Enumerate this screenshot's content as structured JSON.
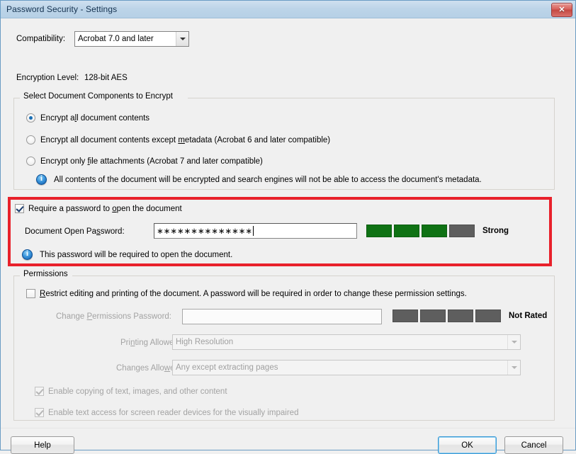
{
  "window": {
    "title": "Password Security - Settings",
    "close_label": "✕"
  },
  "compatibility": {
    "label": "Compatibility:",
    "value": "Acrobat 7.0 and later"
  },
  "encryption": {
    "label": "Encryption  Level:",
    "value": "128-bit AES"
  },
  "encrypt_group": {
    "legend": "Select Document Components to Encrypt",
    "options": [
      {
        "label_pre": "Encrypt a",
        "mnemonic": "l",
        "label_post": "l document contents",
        "checked": true
      },
      {
        "label_pre": "Encrypt all document contents except ",
        "mnemonic": "m",
        "label_post": "etadata (Acrobat 6 and later compatible)",
        "checked": false
      },
      {
        "label_pre": "Encrypt only ",
        "mnemonic": "f",
        "label_post": "ile attachments (Acrobat 7 and later compatible)",
        "checked": false
      }
    ],
    "info_text": "All contents of the document will be encrypted and search engines will not be able to access the document's metadata.",
    "info_icon": "info-icon"
  },
  "open_password": {
    "checkbox_pre": "Require a password to ",
    "checkbox_mnemonic": "o",
    "checkbox_post": "pen the document",
    "checkbox_checked": true,
    "field_label_pre": "Document Open Pa",
    "field_label_mnemonic": "s",
    "field_label_post": "sword:",
    "field_value": "∗∗∗∗∗∗∗∗∗∗∗∗∗∗",
    "strength_label": "Strong",
    "strength_filled": 3,
    "strength_total": 4,
    "info_text": "This password will be required to open the document.",
    "info_icon": "info-icon"
  },
  "permissions_group": {
    "legend": "Permissions",
    "restrict_pre": "",
    "restrict_mnemonic": "R",
    "restrict_post": "estrict editing and printing of the document. A password will be required in order to change these permission settings.",
    "restrict_checked": false,
    "perm_password_label_pre": "Change ",
    "perm_password_label_mnemonic": "P",
    "perm_password_label_post": "ermissions Password:",
    "perm_password_value": "",
    "perm_strength_label": "Not Rated",
    "perm_strength_filled": 0,
    "perm_strength_total": 4,
    "printing": {
      "label_pre": "Pri",
      "label_mnemonic": "n",
      "label_post": "ting Allowed:",
      "value": "High Resolution"
    },
    "changes": {
      "label_pre": "Changes Allo",
      "label_mnemonic": "w",
      "label_post": "ed:",
      "value": "Any except extracting pages"
    },
    "enable_copy": {
      "label": "Enable copying of text, images, and other content",
      "checked": true
    },
    "enable_screenreader": {
      "label": "Enable text access for screen reader devices for the visually impaired",
      "checked": true
    }
  },
  "buttons": {
    "help": "Help",
    "ok": "OK",
    "cancel": "Cancel"
  },
  "colors": {
    "titlebar": "#bcd4e8",
    "annotation": "#e8212b",
    "strength_on": "#0f7214",
    "strength_off": "#5e5e5e",
    "dialog_bg": "#f0f0f0"
  }
}
